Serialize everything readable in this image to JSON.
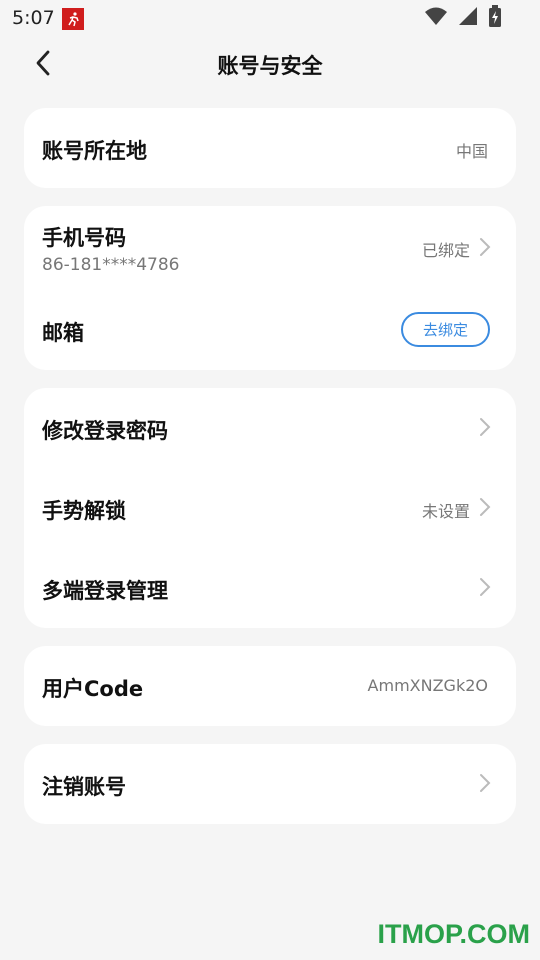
{
  "status_bar": {
    "time": "5:07",
    "app_badge": "⚡",
    "icons": [
      "wifi-icon",
      "signal-icon",
      "battery-icon"
    ]
  },
  "header": {
    "title": "账号与安全"
  },
  "account_region": {
    "label": "账号所在地",
    "value": "中国"
  },
  "phone": {
    "label": "手机号码",
    "number": "86-181****4786",
    "status": "已绑定"
  },
  "email": {
    "label": "邮箱",
    "button": "去绑定"
  },
  "security": {
    "change_password": "修改登录密码",
    "gesture_unlock": "手势解锁",
    "gesture_status": "未设置",
    "multi_device": "多端登录管理"
  },
  "user_code": {
    "label": "用户Code",
    "value": "AmmXNZGk2O"
  },
  "deactivate": {
    "label": "注销账号"
  },
  "watermark": "ITMOP.COM",
  "colors": {
    "accent_blue": "#3b8be0",
    "badge_red": "#d01d1d",
    "watermark_green": "#2aa14a"
  }
}
